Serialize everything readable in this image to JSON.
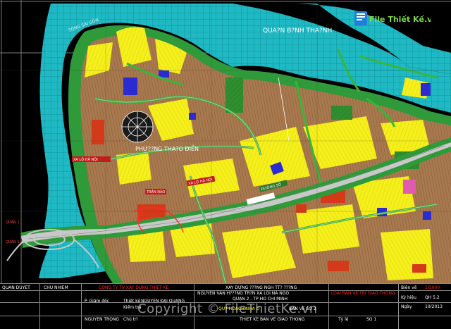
{
  "map": {
    "district_label": "QUA?N B?NH THA?NH",
    "ward_label": "PHƯ??NG THA?O ĐIỀN",
    "road_labels": [
      "XA LỘ HÀ NỘI",
      "XA LỘ HÀ NỘI",
      "TRẦN NÃO",
      "ĐƯỜNG SỐ",
      "QUẬN 1",
      "QUẬN 1"
    ]
  },
  "title_block": {
    "row_top": {
      "col1": "QUAN DUYET",
      "col2": "CHU NHIEM",
      "company": "CONG TY TV XAY DUNG THIET KE",
      "project_head": "XAY DỰNG ???NG NGH TT? ???NG",
      "project_sub": "NGUYEN VAN H???NG TR?N XA LOI NA NGO",
      "project_sub2": "QUẬN 2 - TP HỒ CHÍ MINH",
      "project_sub3": "LOẠI BẢN VẼ TRÍ GIAO THÔNG",
      "scale_label": "Biên vẽ",
      "scale_value": "1/5000",
      "sheet_label": "Ký hiệu",
      "sheet_value": "QH 5.2",
      "date_label": "Ngày",
      "date_value": "10/2013"
    },
    "row_mid": {
      "c1": "P. Giám đốc",
      "c2": "Thiết kế",
      "c3": "NGUYỄN ĐẠI QUANG",
      "c4": "Kiểm tra",
      "c5": "QUY HOẠCH NHÀ Ở",
      "c6": "BẢN VẼ SỐ 2"
    },
    "row_bot": {
      "c1": "NGUYỄN TRỌNG",
      "c2": "Chủ trì",
      "c3": "THIẾT KẾ BẢN VẼ GIAO THÔNG",
      "c4": "Tỷ lệ",
      "c5": "SỐ 1"
    }
  },
  "watermark": {
    "logo_text": "File Thiết Kế.vn",
    "bottom_text": "Copyright © FileThietKe.vn"
  },
  "colors": {
    "background": "#000000",
    "river": "#1fb9c4",
    "river_grid": "#0d8a96",
    "green_road": "#35b83a",
    "road_white": "#c8c8c8",
    "yellow_zone": "#f5ef1b",
    "tan_zone": "#a8794e",
    "red_zone": "#d43a1a",
    "blue_block": "#2b2bd4",
    "pink_block": "#e05ab0",
    "logo_green": "#7fd64a",
    "logo_blue": "#1e7fd8"
  }
}
